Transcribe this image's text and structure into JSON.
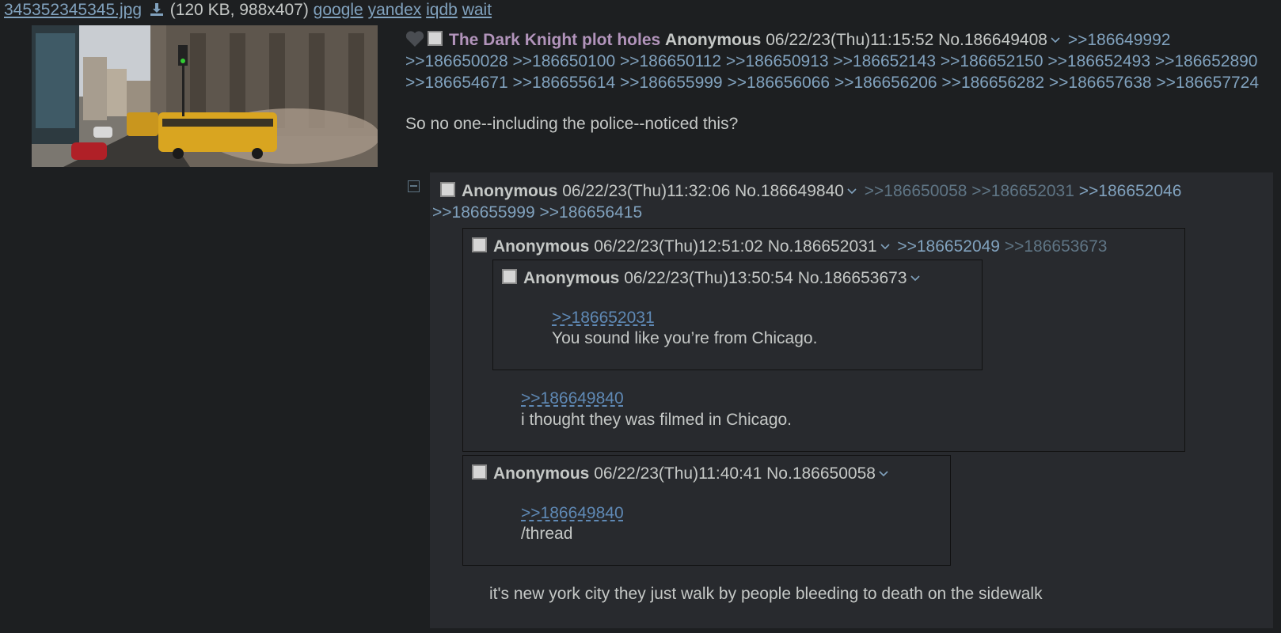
{
  "file": {
    "name": "345352345345.jpg",
    "meta": "(120 KB, 988x407)",
    "links": [
      "google",
      "yandex",
      "iqdb",
      "wait"
    ]
  },
  "op": {
    "subject": "The Dark Knight plot holes",
    "name": "Anonymous",
    "datetime": "06/22/23(Thu)11:15:52",
    "no": "No.186649408",
    "replies": [
      ">>186649992",
      ">>186650028",
      ">>186650100",
      ">>186650112",
      ">>186650913",
      ">>186652143",
      ">>186652150",
      ">>186652493",
      ">>186652890",
      ">>186654671",
      ">>186655614",
      ">>186655999",
      ">>186656066",
      ">>186656206",
      ">>186656282",
      ">>186657638",
      ">>186657724"
    ],
    "body": "So no one--including the police--noticed this?"
  },
  "post1": {
    "name": "Anonymous",
    "datetime": "06/22/23(Thu)11:32:06",
    "no": "No.186649840",
    "replies": [
      ">>186650058",
      ">>186652031",
      ">>186652046",
      ">>186655999",
      ">>186656415"
    ],
    "body": "it's new york city they just walk by people bleeding to death on the sidewalk"
  },
  "post2": {
    "name": "Anonymous",
    "datetime": "06/22/23(Thu)12:51:02",
    "no": "No.186652031",
    "replies": [
      ">>186652049",
      ">>186653673"
    ],
    "quote": ">>186649840",
    "body": "i thought they was filmed in Chicago."
  },
  "post3": {
    "name": "Anonymous",
    "datetime": "06/22/23(Thu)13:50:54",
    "no": "No.186653673",
    "quote": ">>186652031",
    "body": "You sound like you’re from Chicago."
  },
  "post4": {
    "name": "Anonymous",
    "datetime": "06/22/23(Thu)11:40:41",
    "no": "No.186650058",
    "quote": ">>186649840",
    "body": "/thread"
  }
}
